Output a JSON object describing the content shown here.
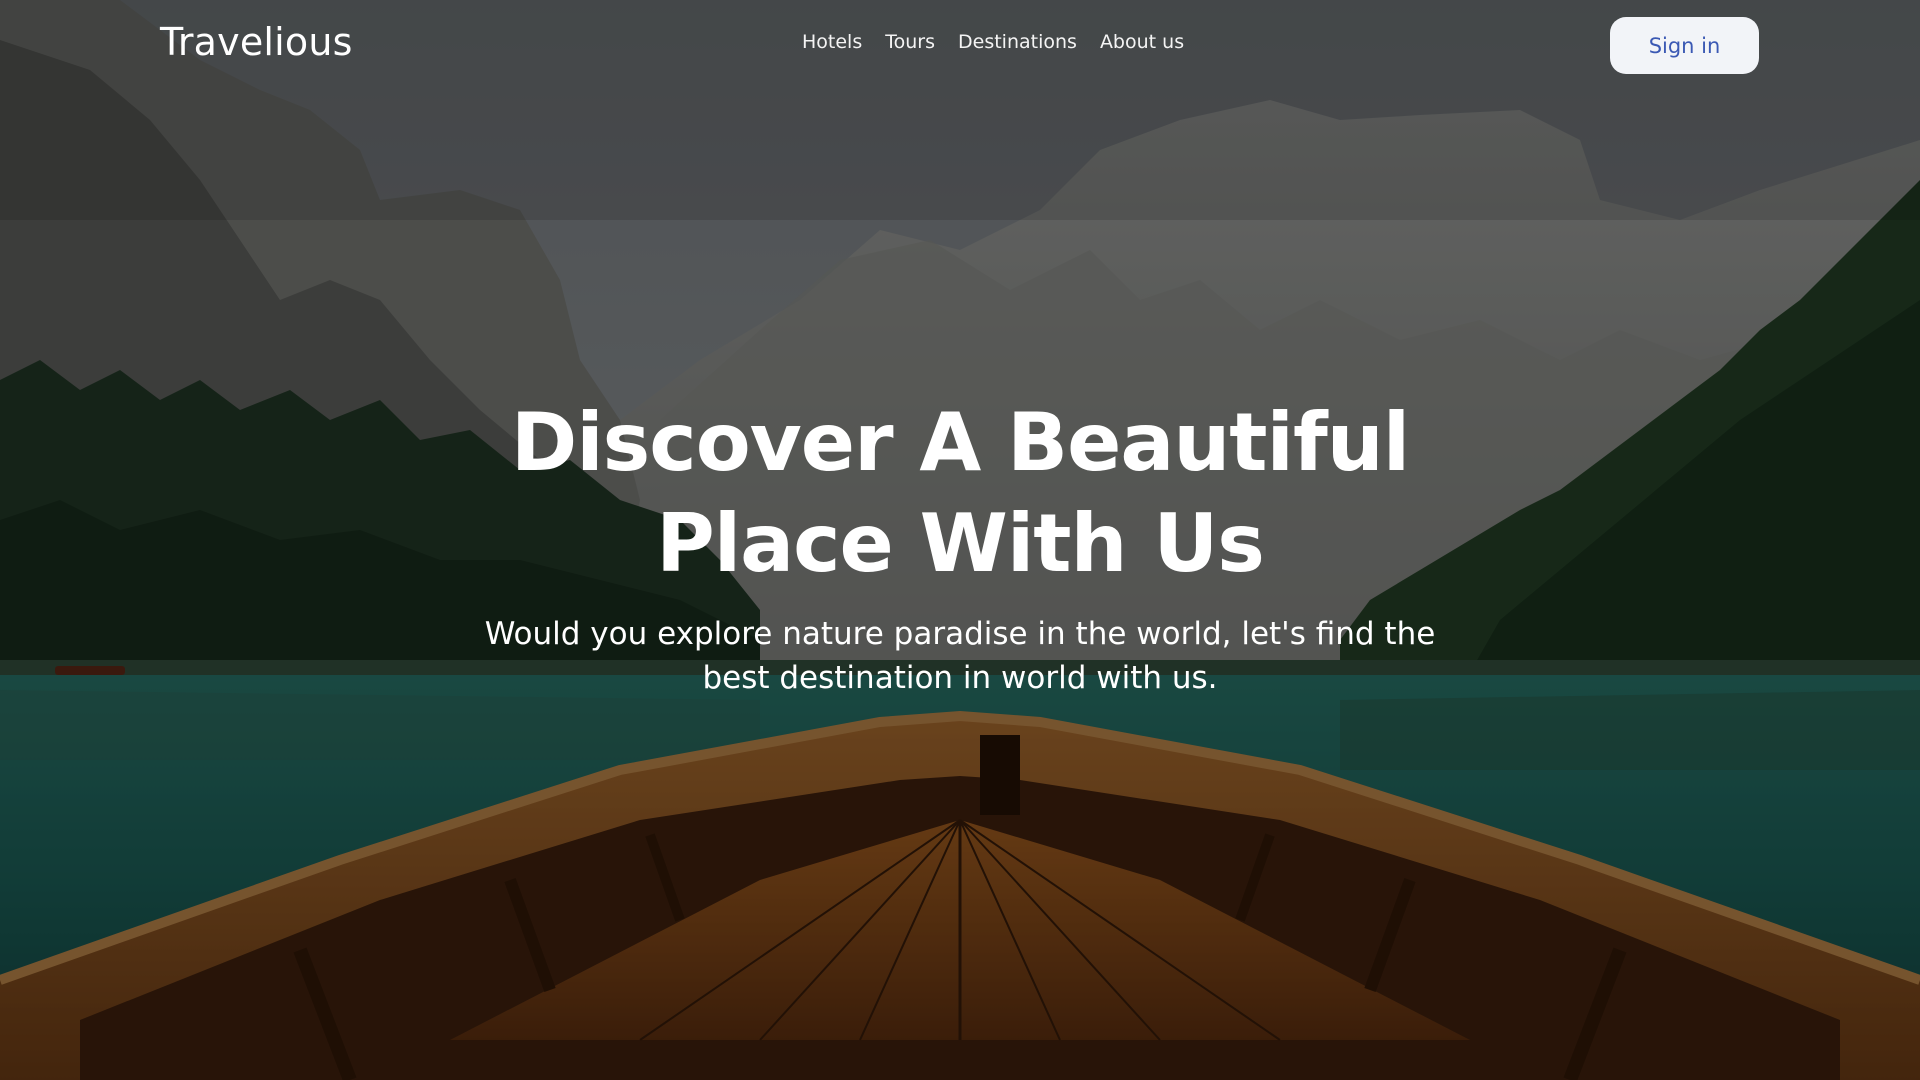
{
  "brand": {
    "name": "Travelious"
  },
  "nav": {
    "links": [
      "Hotels",
      "Tours",
      "Destinations",
      "About us"
    ],
    "signin_label": "Sign in"
  },
  "hero": {
    "title_lines": [
      "Discover A Beautiful",
      "Place With Us"
    ],
    "subtitle_lines": [
      "Would you explore nature paradise in the world, let's find the",
      "best destination in world with us."
    ],
    "background": "Mountain lake viewed from the bow of a wooden rowboat"
  },
  "colors": {
    "overlay": "#000000",
    "button_bg": "#f2f4f8",
    "button_text": "#3b59b4",
    "text": "#ffffff"
  }
}
